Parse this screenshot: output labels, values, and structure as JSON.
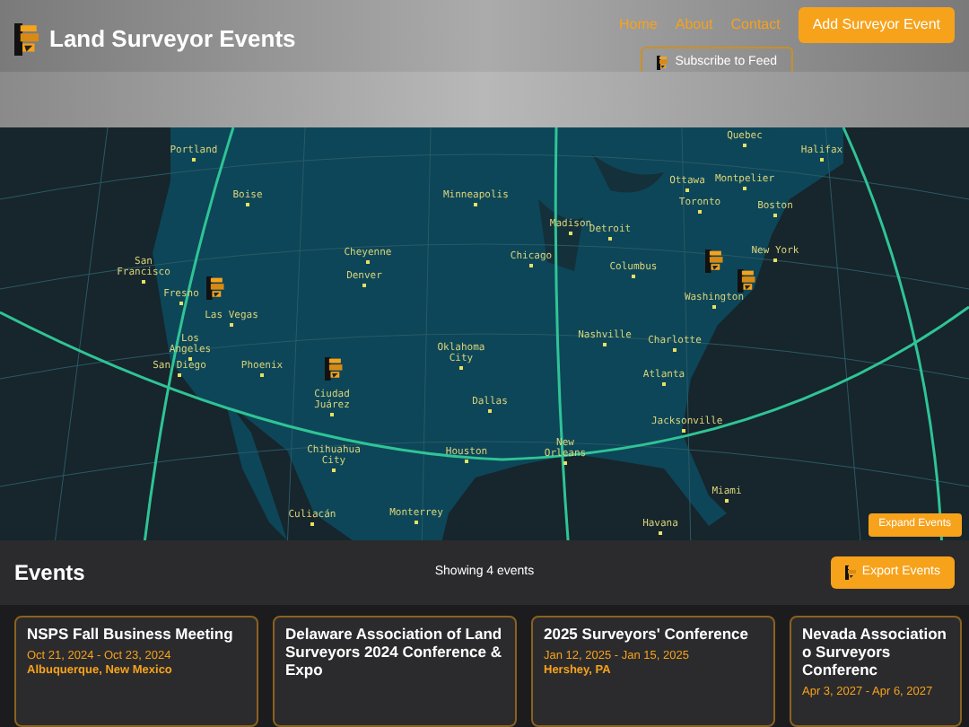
{
  "header": {
    "title": "Land Surveyor Events",
    "nav": [
      {
        "label": "Home"
      },
      {
        "label": "About"
      },
      {
        "label": "Contact"
      }
    ],
    "add_button": "Add Surveyor Event",
    "subscribe_button": "Subscribe to Feed"
  },
  "map": {
    "cities": [
      "Portland",
      "Boise",
      "Minneapolis",
      "San Francisco",
      "Cheyenne",
      "Denver",
      "Fresno",
      "Las Vegas",
      "Los Angeles",
      "San Diego",
      "Phoenix",
      "Oklahoma City",
      "Ciudad Juárez",
      "Dallas",
      "Chihuahua City",
      "Houston",
      "Culiacán",
      "Monterrey",
      "Quebec",
      "Halifax",
      "Ottawa",
      "Montpelier",
      "Toronto",
      "Boston",
      "Madison",
      "Detroit",
      "Chicago",
      "New York",
      "Columbus",
      "Washington",
      "Nashville",
      "Charlotte",
      "Atlanta",
      "Jacksonville",
      "New Orleans",
      "Miami",
      "Havana"
    ],
    "expand_button": "Expand Events"
  },
  "events_bar": {
    "title": "Events",
    "count": "Showing 4 events",
    "export_button": "Export Events"
  },
  "events": [
    {
      "title": "NSPS Fall Business Meeting",
      "dates": "Oct 21, 2024 - Oct 23, 2024",
      "location": "Albuquerque, New Mexico"
    },
    {
      "title": "Delaware Association of Land Surveyors 2024 Conference & Expo"
    },
    {
      "title": "2025 Surveyors' Conference",
      "dates": "Jan 12, 2025 - Jan 15, 2025",
      "location": "Hershey, PA"
    },
    {
      "title": "Nevada Association o Surveyors Conferenc",
      "dates": "Apr 3, 2027 - Apr 6, 2027"
    }
  ]
}
